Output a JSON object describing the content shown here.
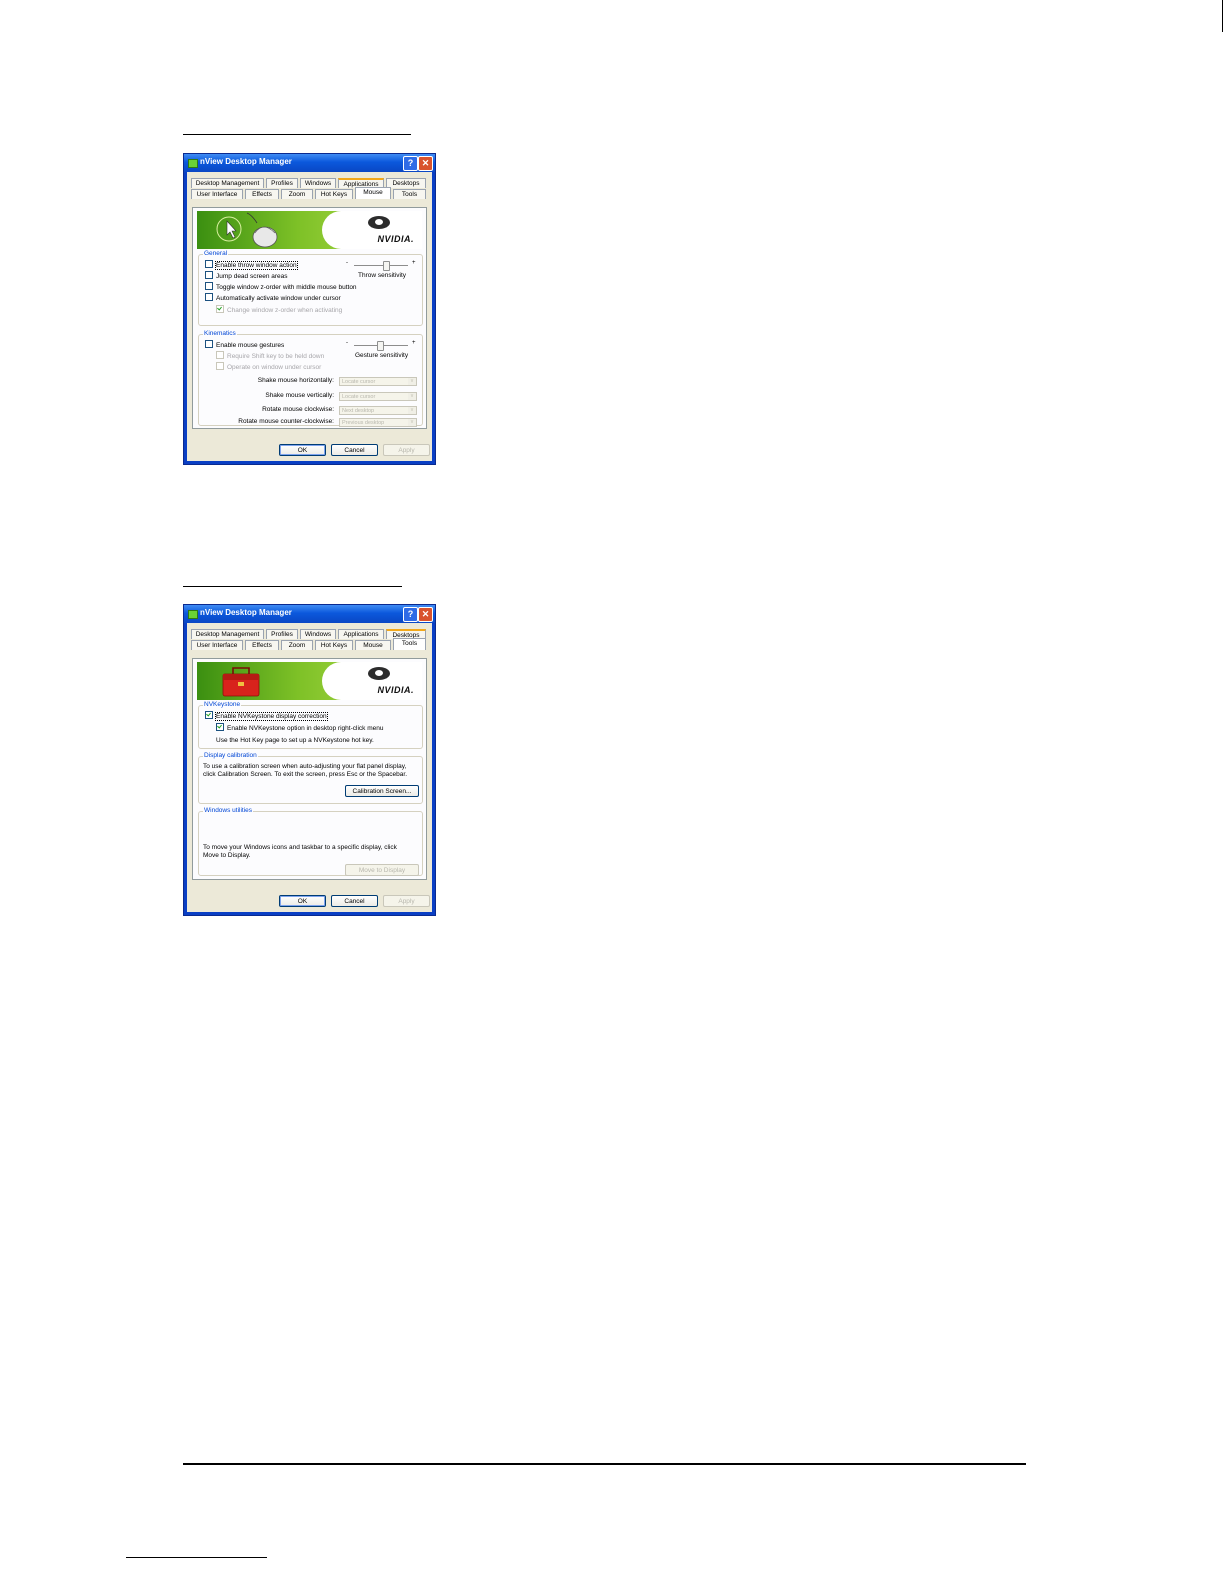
{
  "dialog_title": "nView Desktop Manager",
  "tabs_row1": [
    "Desktop Management",
    "Profiles",
    "Windows",
    "Applications",
    "Desktops"
  ],
  "tabs_row2": [
    "User Interface",
    "Effects",
    "Zoom",
    "Hot Keys",
    "Mouse",
    "Tools"
  ],
  "brand": "NVIDIA.",
  "buttons": {
    "ok": "OK",
    "cancel": "Cancel",
    "apply": "Apply",
    "help": "?",
    "close": "✕"
  },
  "mouse_dialog": {
    "active_tab": "Mouse",
    "general": {
      "legend": "General",
      "items": [
        {
          "label": "Enable throw window action",
          "checked": false
        },
        {
          "label": "Jump dead screen areas",
          "checked": false
        },
        {
          "label": "Toggle window z-order with middle mouse button",
          "checked": false
        },
        {
          "label": "Automatically activate window under cursor",
          "checked": false
        },
        {
          "label": "Change window z-order when activating",
          "checked": true,
          "disabled": true
        }
      ],
      "slider_label": "Throw sensitivity",
      "slider_min": "-",
      "slider_max": "+"
    },
    "kinematics": {
      "legend": "Kinematics",
      "items": [
        {
          "label": "Enable mouse gestures",
          "checked": false
        },
        {
          "label": "Require Shift key to be held down",
          "checked": false,
          "disabled": true
        },
        {
          "label": "Operate on window under cursor",
          "checked": false,
          "disabled": true
        }
      ],
      "slider_label": "Gesture sensitivity",
      "slider_min": "-",
      "slider_max": "+",
      "combos": [
        {
          "label": "Shake mouse horizontally:",
          "value": "Locate cursor"
        },
        {
          "label": "Shake mouse vertically:",
          "value": "Locate cursor"
        },
        {
          "label": "Rotate mouse clockwise:",
          "value": "Next desktop"
        },
        {
          "label": "Rotate mouse counter-clockwise:",
          "value": "Previous desktop"
        }
      ]
    }
  },
  "tools_dialog": {
    "active_tab": "Tools",
    "nvkeystone": {
      "legend": "NVKeystone",
      "enable": {
        "label": "Enable NVKeystone display correction",
        "checked": true
      },
      "menu": {
        "label": "Enable NVKeystone option in desktop right-click menu",
        "checked": true
      },
      "hint": "Use the Hot Key page to set up a NVKeystone hot key."
    },
    "calibration": {
      "legend": "Display calibration",
      "text_line1": "To use a calibration screen when auto-adjusting your flat panel display,",
      "text_line2": "click Calibration Screen. To exit the screen, press Esc or the Spacebar.",
      "button": "Calibration Screen..."
    },
    "windows_utilities": {
      "legend": "Windows utilities",
      "text_line1": "To move your Windows icons and taskbar to a specific display, click",
      "text_line2": "Move to Display.",
      "button": "Move to Display"
    }
  }
}
